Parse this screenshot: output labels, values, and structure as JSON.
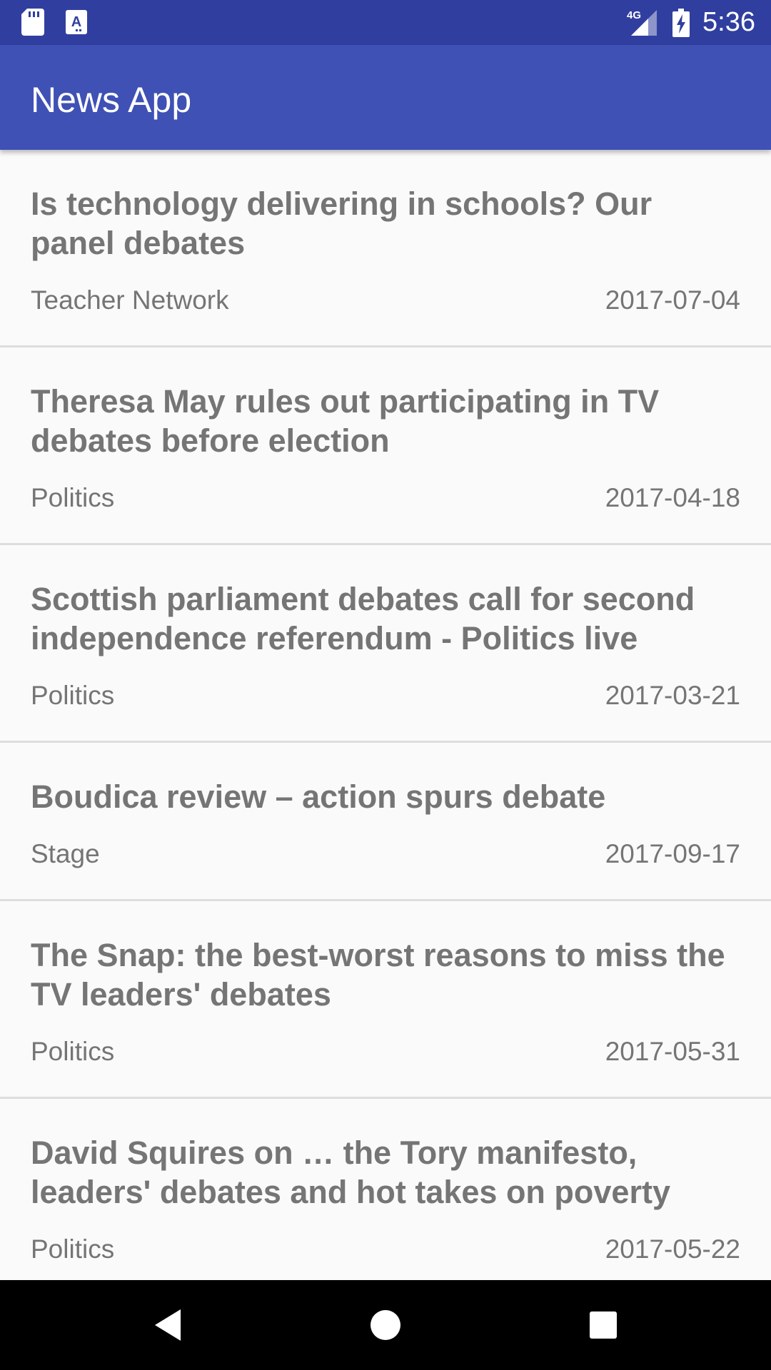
{
  "status_bar": {
    "time": "5:36",
    "network": "4G",
    "icons": [
      "sd-card-icon",
      "a-badge-icon",
      "signal-icon",
      "battery-charging-icon"
    ]
  },
  "app_bar": {
    "title": "News App"
  },
  "articles": [
    {
      "title": "Is technology delivering in schools? Our panel debates",
      "section": "Teacher Network",
      "date": "2017-07-04"
    },
    {
      "title": "Theresa May rules out participating in TV debates before election",
      "section": "Politics",
      "date": "2017-04-18"
    },
    {
      "title": "Scottish parliament debates call for second independence referendum - Politics live",
      "section": "Politics",
      "date": "2017-03-21"
    },
    {
      "title": "Boudica review – action spurs debate",
      "section": "Stage",
      "date": "2017-09-17"
    },
    {
      "title": "The Snap: the best-worst reasons to miss the TV leaders' debates",
      "section": "Politics",
      "date": "2017-05-31"
    },
    {
      "title": "David Squires on … the Tory manifesto, leaders' debates and hot takes on poverty",
      "section": "Politics",
      "date": "2017-05-22"
    }
  ],
  "nav_bar": {
    "buttons": [
      "back-icon",
      "home-icon",
      "recents-icon"
    ]
  },
  "colors": {
    "status_bar": "#303f9f",
    "app_bar": "#3f51b5",
    "text": "#757575",
    "divider": "#dddddd"
  }
}
